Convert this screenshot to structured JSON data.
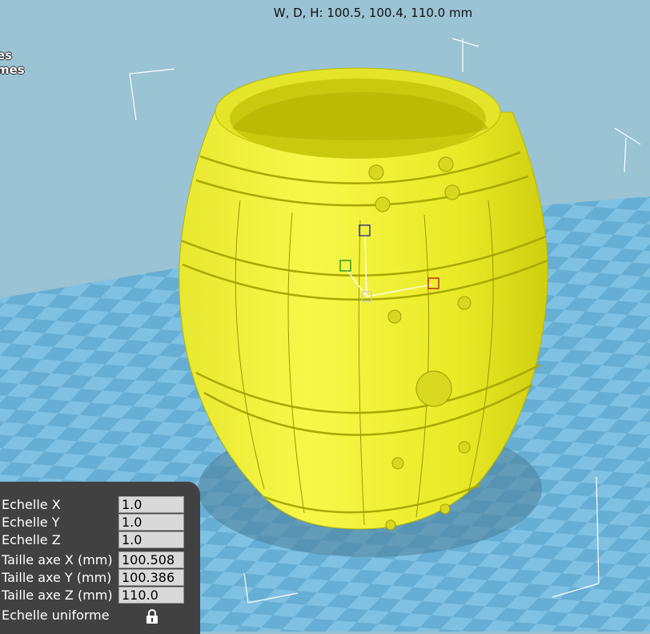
{
  "viewport": {
    "dimensions_label": "W, D, H: 100.5, 100.4, 110.0 mm",
    "side_text": [
      "es",
      "mes"
    ],
    "model_color": "#f2f22a",
    "background_color": "#9ac3d4"
  },
  "scale_panel": {
    "rows": [
      {
        "label": "Echelle X",
        "value": "1.0"
      },
      {
        "label": "Echelle Y",
        "value": "1.0"
      },
      {
        "label": "Echelle Z",
        "value": "1.0"
      },
      {
        "label": "Taille axe X (mm)",
        "value": "100.508"
      },
      {
        "label": "Taille axe Y (mm)",
        "value": "100.386"
      },
      {
        "label": "Taille axe Z (mm)",
        "value": "110.0"
      }
    ],
    "uniform_label": "Echelle uniforme",
    "uniform_icon": "lock-icon"
  }
}
